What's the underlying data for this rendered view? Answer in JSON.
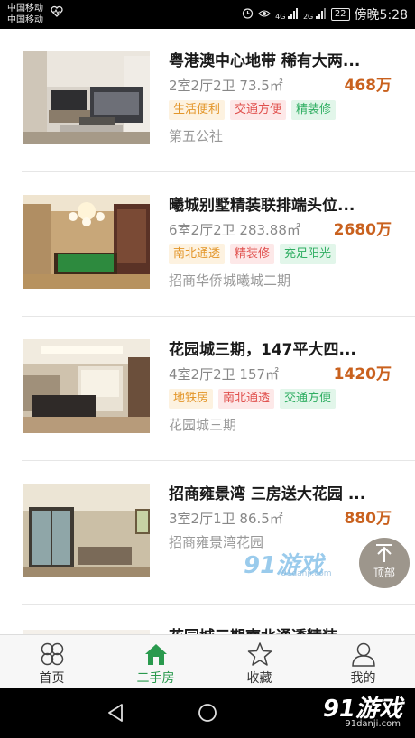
{
  "status_bar": {
    "carrier_1": "中国移动",
    "carrier_2": "中国移动",
    "network_1": "4G",
    "network_2": "2G",
    "battery": "22",
    "time": "傍晚5:28"
  },
  "listings": [
    {
      "title": "粤港澳中心地带 稀有大两...",
      "spec": "2室2厅2卫 73.5㎡",
      "price": "468万",
      "tags": [
        {
          "text": "生活便利",
          "color": "orange"
        },
        {
          "text": "交通方便",
          "color": "red"
        },
        {
          "text": "精装修",
          "color": "green"
        }
      ],
      "community": "第五公社"
    },
    {
      "title": "曦城别墅精装联排端头位...",
      "spec": "6室2厅2卫 283.88㎡",
      "price": "2680万",
      "tags": [
        {
          "text": "南北通透",
          "color": "orange"
        },
        {
          "text": "精装修",
          "color": "red"
        },
        {
          "text": "充足阳光",
          "color": "green"
        }
      ],
      "community": "招商华侨城曦城二期"
    },
    {
      "title": "花园城三期，147平大四...",
      "spec": "4室2厅2卫 157㎡",
      "price": "1420万",
      "tags": [
        {
          "text": "地铁房",
          "color": "orange"
        },
        {
          "text": "南北通透",
          "color": "red"
        },
        {
          "text": "交通方便",
          "color": "green"
        }
      ],
      "community": "花园城三期"
    },
    {
      "title": "招商雍景湾 三房送大花园 ...",
      "spec": "3室2厅1卫 86.5㎡",
      "price": "880万",
      "tags": [],
      "community": "招商雍景湾花园"
    },
    {
      "title": "花园城三期南北通透精装...",
      "spec": "",
      "price": "",
      "tags": [],
      "community": ""
    }
  ],
  "back_to_top": {
    "label": "顶部"
  },
  "watermark": {
    "big": "91游戏",
    "small": "91danji.com"
  },
  "tabs": [
    {
      "label": "首页",
      "icon": "home-grid-icon"
    },
    {
      "label": "二手房",
      "icon": "house-icon",
      "active": true
    },
    {
      "label": "收藏",
      "icon": "star-icon"
    },
    {
      "label": "我的",
      "icon": "user-icon"
    }
  ],
  "colors": {
    "accent": "#2a9a4e",
    "price": "#c9611e"
  }
}
